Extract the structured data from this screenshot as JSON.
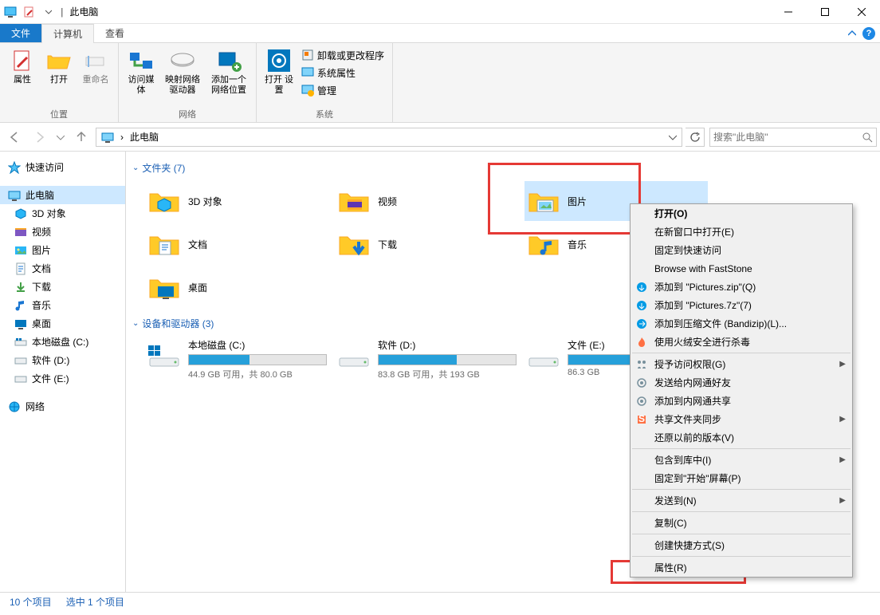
{
  "window": {
    "title": "此电脑"
  },
  "tabs": {
    "file": "文件",
    "computer": "计算机",
    "view": "查看"
  },
  "ribbon": {
    "location": {
      "label": "位置",
      "properties": "属性",
      "open": "打开",
      "rename": "重命名"
    },
    "network": {
      "label": "网络",
      "media": "访问媒体",
      "map": "映射网络\n驱动器",
      "addloc": "添加一个\n网络位置"
    },
    "system": {
      "label": "系统",
      "settings": "打开\n设置",
      "uninstall": "卸载或更改程序",
      "sysprops": "系统属性",
      "manage": "管理"
    }
  },
  "breadcrumb": {
    "thispc": "此电脑"
  },
  "search": {
    "placeholder": "搜索\"此电脑\""
  },
  "sidebar": {
    "quick": "快速访问",
    "thispc": "此电脑",
    "items": [
      "3D 对象",
      "视频",
      "图片",
      "文档",
      "下载",
      "音乐",
      "桌面",
      "本地磁盘 (C:)",
      "软件 (D:)",
      "文件 (E:)"
    ],
    "network": "网络"
  },
  "groups": {
    "folders": {
      "label": "文件夹 (7)"
    },
    "drives": {
      "label": "设备和驱动器 (3)"
    }
  },
  "folders": [
    {
      "name": "3D 对象"
    },
    {
      "name": "视频"
    },
    {
      "name": "图片"
    },
    {
      "name": "文档"
    },
    {
      "name": "下载"
    },
    {
      "name": "音乐"
    },
    {
      "name": "桌面"
    }
  ],
  "drives": [
    {
      "name": "本地磁盘 (C:)",
      "text": "44.9 GB 可用，共 80.0 GB",
      "pct": 44
    },
    {
      "name": "软件 (D:)",
      "text": "83.8 GB 可用，共 193 GB",
      "pct": 57
    },
    {
      "name": "文件 (E:)",
      "text": "86.3 GB",
      "pct": 50
    }
  ],
  "context": {
    "open": "打开(O)",
    "newwin": "在新窗口中打开(E)",
    "pin": "固定到快速访问",
    "faststone": "Browse with FastStone",
    "zip": "添加到 \"Pictures.zip\"(Q)",
    "sevenz": "添加到 \"Pictures.7z\"(7)",
    "bandizip": "添加到压缩文件 (Bandizip)(L)...",
    "huorong": "使用火绒安全进行杀毒",
    "access": "授予访问权限(G)",
    "sendfriend": "发送给内网通好友",
    "sharenet": "添加到内网通共享",
    "sharesync": "共享文件夹同步",
    "restore": "还原以前的版本(V)",
    "library": "包含到库中(I)",
    "pinstart": "固定到\"开始\"屏幕(P)",
    "sendto": "发送到(N)",
    "copy": "复制(C)",
    "shortcut": "创建快捷方式(S)",
    "props": "属性(R)"
  },
  "status": {
    "count": "10 个项目",
    "selected": "选中 1 个项目"
  }
}
